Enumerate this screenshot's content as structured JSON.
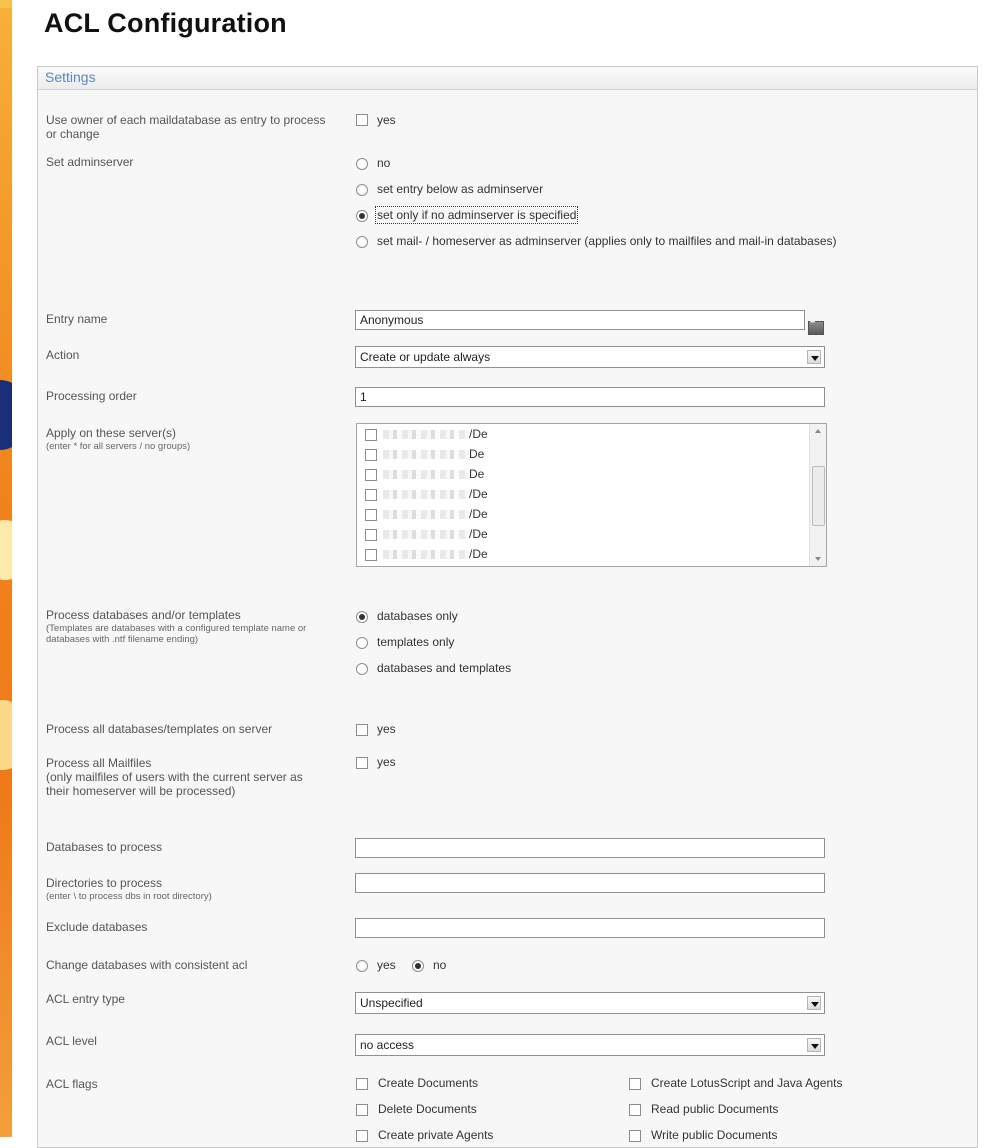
{
  "page": {
    "title": "ACL Configuration"
  },
  "panel": {
    "header": "Settings"
  },
  "colors": {
    "header_text": "#5a86c5",
    "background_accent": "#f0821c"
  },
  "fields": {
    "use_owner": {
      "label": "Use owner of each maildatabase as entry to process or change",
      "option": "yes",
      "checked": false
    },
    "set_adminserver": {
      "label": "Set adminserver",
      "options": [
        "no",
        "set entry below as adminserver",
        "set only if no adminserver is specified",
        "set mail- / homeserver as adminserver (applies only to mailfiles and mail-in databases)"
      ],
      "selected": "set only if no adminserver is specified"
    },
    "entry_name": {
      "label": "Entry name",
      "value": "Anonymous"
    },
    "action": {
      "label": "Action",
      "value": "Create or update always"
    },
    "processing_order": {
      "label": "Processing order",
      "value": "1"
    },
    "apply_servers": {
      "label": "Apply on these server(s)",
      "hint": "(enter * for all servers / no groups)",
      "items": [
        "/De",
        "De",
        "De",
        "/De",
        "/De",
        "/De",
        "/De"
      ]
    },
    "process_type": {
      "label": "Process databases and/or templates",
      "hint": "(Templates are databases with a configured template name or databases with .ntf filename ending)",
      "options": [
        "databases only",
        "templates only",
        "databases and templates"
      ],
      "selected": "databases only"
    },
    "process_all_dbs": {
      "label": "Process all databases/templates on server",
      "option": "yes",
      "checked": false
    },
    "process_all_mailfiles": {
      "label": "Process all Mailfiles",
      "hint": "(only mailfiles of users with the current server as their homeserver will be processed)",
      "option": "yes",
      "checked": false
    },
    "dbs_to_process": {
      "label": "Databases to process",
      "value": ""
    },
    "dirs_to_process": {
      "label": "Directories to process",
      "hint": "(enter \\ to process dbs in root directory)",
      "value": ""
    },
    "exclude_dbs": {
      "label": "Exclude databases",
      "value": ""
    },
    "consistent_acl": {
      "label": "Change databases with consistent acl",
      "options": [
        "yes",
        "no"
      ],
      "selected": "no"
    },
    "acl_entry_type": {
      "label": "ACL entry type",
      "value": "Unspecified"
    },
    "acl_level": {
      "label": "ACL level",
      "value": "no access"
    },
    "acl_flags": {
      "label": "ACL flags",
      "left": [
        "Create Documents",
        "Delete Documents",
        "Create private Agents"
      ],
      "right": [
        "Create LotusScript and Java Agents",
        "Read public Documents",
        "Write public Documents"
      ]
    }
  }
}
